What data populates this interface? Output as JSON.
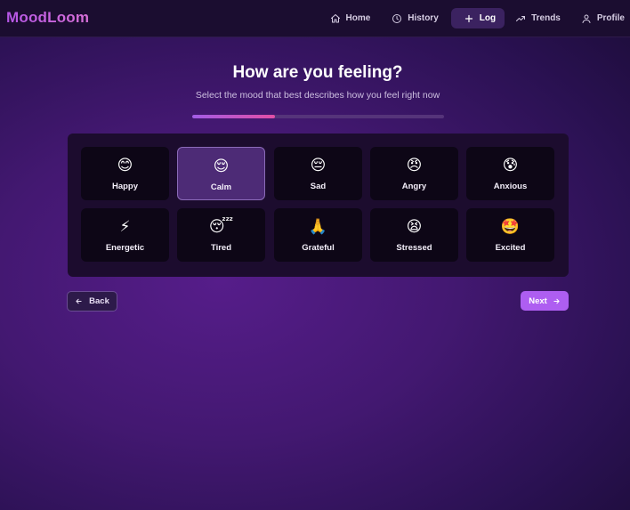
{
  "app": {
    "name": "MoodLoom"
  },
  "nav": {
    "items": [
      {
        "label": "Home",
        "icon": "home-icon"
      },
      {
        "label": "History",
        "icon": "clock-icon"
      },
      {
        "label": "Log",
        "icon": "plus-icon",
        "active": true
      },
      {
        "label": "Trends",
        "icon": "trending-up-icon"
      },
      {
        "label": "Profile",
        "icon": "user-icon"
      }
    ]
  },
  "page": {
    "title": "How are you feeling?",
    "subtitle": "Select the mood that best describes how you feel right now",
    "progress": 0.33
  },
  "moods": [
    {
      "label": "Happy",
      "emoji": "😊"
    },
    {
      "label": "Calm",
      "emoji": "😌",
      "selected": true
    },
    {
      "label": "Sad",
      "emoji": "😔"
    },
    {
      "label": "Angry",
      "emoji": "😠"
    },
    {
      "label": "Anxious",
      "emoji": "😰"
    },
    {
      "label": "Energetic",
      "emoji": "⚡"
    },
    {
      "label": "Tired",
      "emoji": "😴"
    },
    {
      "label": "Grateful",
      "emoji": "🙏"
    },
    {
      "label": "Stressed",
      "emoji": "😫"
    },
    {
      "label": "Excited",
      "emoji": "🤩"
    }
  ],
  "actions": {
    "back_label": "Back",
    "next_label": "Next"
  },
  "colors": {
    "accent": "#ae5ef1",
    "selected_card": "#4d2b76",
    "background": "#431871"
  }
}
